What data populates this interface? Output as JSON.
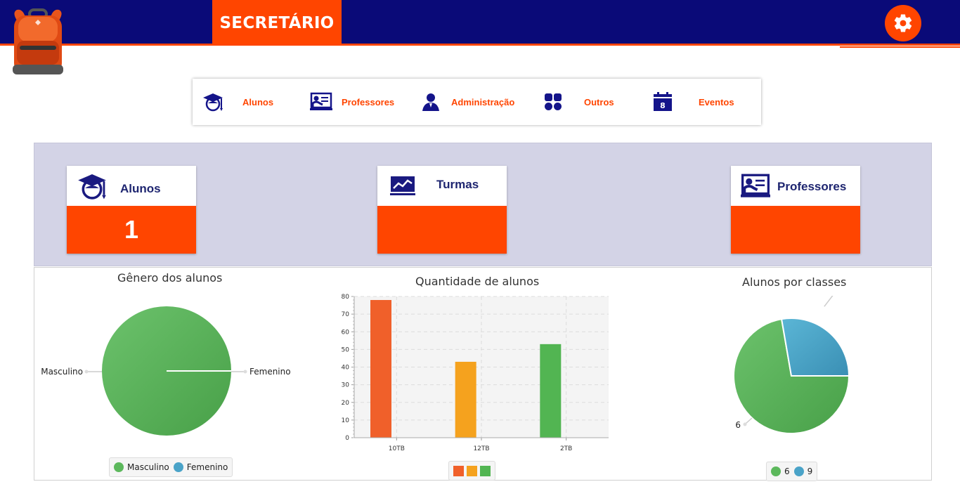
{
  "header": {
    "title": "SECRETÁRIO",
    "logo_icon": "backpack-icon",
    "settings_icon": "gear-icon",
    "bar_color": "#0a0a78",
    "accent_color": "#ff4500"
  },
  "nav": {
    "items": [
      {
        "label": "Alunos",
        "icon": "graduate-icon"
      },
      {
        "label": "Professores",
        "icon": "teacher-board-icon"
      },
      {
        "label": "Administração",
        "icon": "user-icon"
      },
      {
        "label": "Outros",
        "icon": "shapes-icon"
      },
      {
        "label": "Eventos",
        "icon": "calendar-icon",
        "icon_text": "8"
      }
    ]
  },
  "stats": [
    {
      "title": "Alunos",
      "value": "1",
      "icon": "graduate-icon"
    },
    {
      "title": "Turmas",
      "value": "",
      "icon": "chart-board-icon"
    },
    {
      "title": "Professores",
      "value": "",
      "icon": "teacher-board-icon"
    }
  ],
  "chart_data": [
    {
      "type": "pie",
      "title": "Gênero dos alunos",
      "slices": [
        {
          "label": "Masculino",
          "value": 1,
          "color": "#5cb85c"
        },
        {
          "label": "Femenino",
          "value": 0,
          "color": "#4aa3c8"
        }
      ],
      "legend": [
        "Masculino",
        "Femenino"
      ],
      "legend_position": "bottom"
    },
    {
      "type": "bar",
      "title": "Quantidade de alunos",
      "categories": [
        "10TB",
        "12TB",
        "2TB"
      ],
      "values": [
        78,
        43,
        53
      ],
      "colors": [
        "#f0602a",
        "#f5a21e",
        "#52b552"
      ],
      "ylim": [
        0,
        80
      ],
      "yticks": [
        0,
        10,
        20,
        30,
        40,
        50,
        60,
        70,
        80
      ],
      "grid": true,
      "legend_position": "bottom"
    },
    {
      "type": "pie",
      "title": "Alunos por classes",
      "slices": [
        {
          "label": "6",
          "value": 6,
          "color": "#5cb85c"
        },
        {
          "label": "9",
          "value": 2.3,
          "color": "#4aa3c8"
        }
      ],
      "legend": [
        "6",
        "9"
      ],
      "legend_position": "bottom"
    }
  ]
}
